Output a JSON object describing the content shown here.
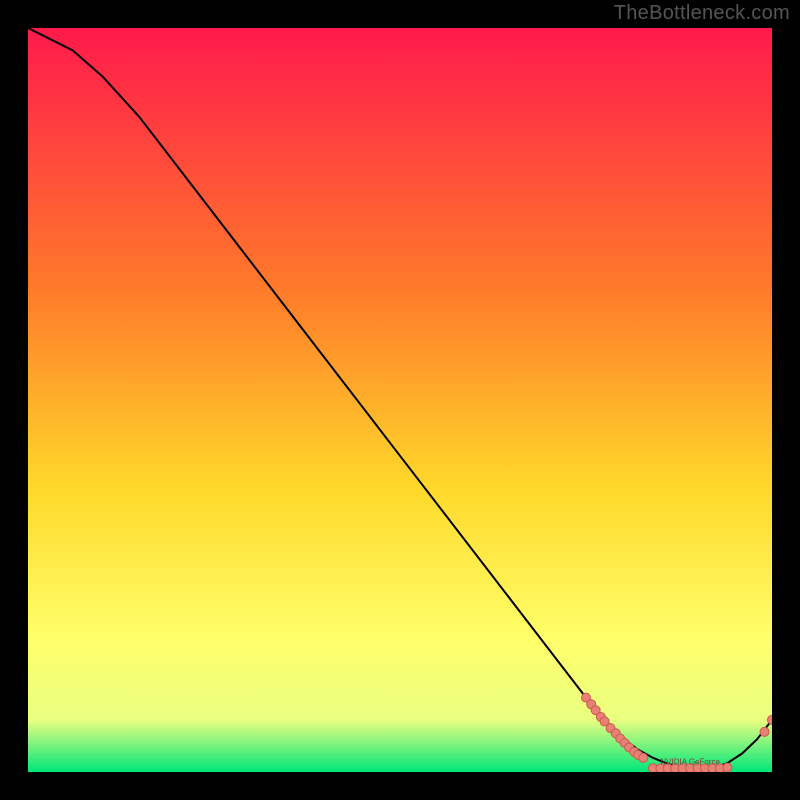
{
  "watermark": "TheBottleneck.com",
  "colors": {
    "background": "#000000",
    "gradient_top": "#ff1a4b",
    "gradient_mid1": "#ff7a2a",
    "gradient_mid2": "#ffd92a",
    "gradient_mid3": "#ffff6a",
    "gradient_bottom": "#00e67a",
    "curve": "#000000",
    "dot_fill": "#e98074",
    "dot_stroke": "#c85a4e"
  },
  "chart_data": {
    "type": "line",
    "title": "",
    "xlabel": "",
    "ylabel": "",
    "xlim": [
      0,
      100
    ],
    "ylim": [
      0,
      100
    ],
    "curve": {
      "x": [
        0,
        6,
        10,
        15,
        20,
        30,
        40,
        50,
        60,
        70,
        75,
        78,
        80,
        82,
        84,
        86,
        88,
        90,
        92,
        94,
        96,
        98,
        100
      ],
      "y": [
        100,
        97,
        93.5,
        88,
        81.5,
        68.5,
        55.5,
        42.5,
        29.5,
        16.5,
        10,
        6.5,
        4.5,
        3,
        1.9,
        1.1,
        0.6,
        0.4,
        0.5,
        1.2,
        2.5,
        4.4,
        7.0
      ]
    },
    "dots": [
      {
        "x": 75.0,
        "y": 10.0
      },
      {
        "x": 75.7,
        "y": 9.1
      },
      {
        "x": 76.3,
        "y": 8.3
      },
      {
        "x": 77.0,
        "y": 7.4
      },
      {
        "x": 77.5,
        "y": 6.8
      },
      {
        "x": 78.3,
        "y": 5.9
      },
      {
        "x": 79.0,
        "y": 5.2
      },
      {
        "x": 79.6,
        "y": 4.5
      },
      {
        "x": 80.2,
        "y": 3.9
      },
      {
        "x": 80.8,
        "y": 3.3
      },
      {
        "x": 81.5,
        "y": 2.7
      },
      {
        "x": 82.0,
        "y": 2.3
      },
      {
        "x": 82.7,
        "y": 1.9
      },
      {
        "x": 84.0,
        "y": 0.5
      },
      {
        "x": 85.0,
        "y": 0.5
      },
      {
        "x": 86.0,
        "y": 0.5
      },
      {
        "x": 87.0,
        "y": 0.5
      },
      {
        "x": 88.0,
        "y": 0.5
      },
      {
        "x": 89.0,
        "y": 0.5
      },
      {
        "x": 90.0,
        "y": 0.5
      },
      {
        "x": 91.0,
        "y": 0.5
      },
      {
        "x": 92.0,
        "y": 0.5
      },
      {
        "x": 93.0,
        "y": 0.5
      },
      {
        "x": 94.0,
        "y": 0.6
      },
      {
        "x": 99.0,
        "y": 5.4
      },
      {
        "x": 100.0,
        "y": 7.0
      }
    ],
    "dot_label": "NVIDIA GeForce"
  }
}
